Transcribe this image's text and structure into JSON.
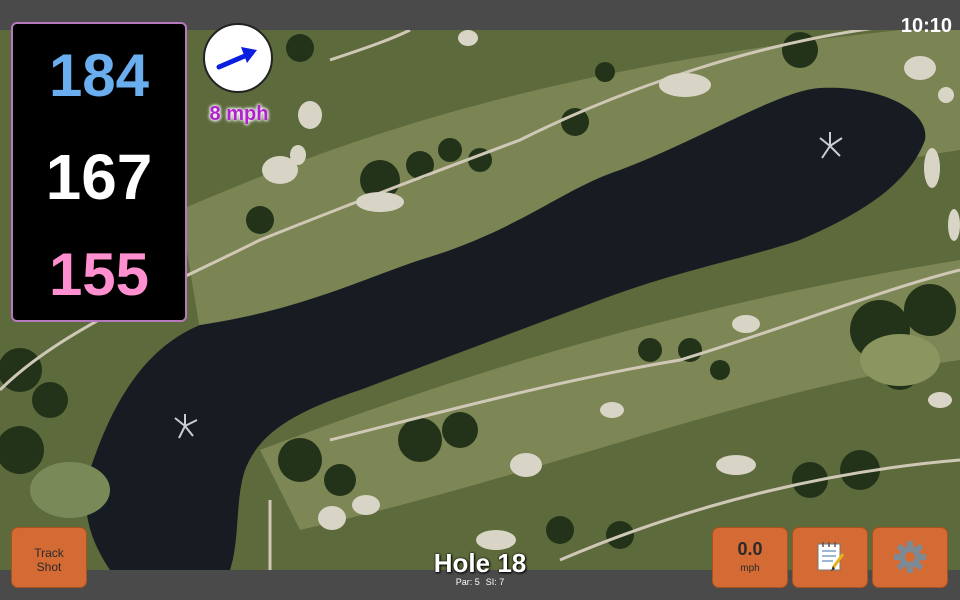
{
  "status": {
    "time": "10:10"
  },
  "distances": {
    "back": "184",
    "middle": "167",
    "front": "155"
  },
  "wind": {
    "speed_text": "8 mph",
    "direction_icon": "arrow-icon",
    "arrow_color": "#0a1ee0"
  },
  "hole": {
    "title": "Hole 18",
    "par": "Par: 5",
    "si": "SI: 7"
  },
  "buttons": {
    "track_shot_line1": "Track",
    "track_shot_line2": "Shot",
    "speed_value": "0.0",
    "speed_unit": "mph",
    "notes_icon": "notepad-icon",
    "settings_icon": "gear-icon"
  },
  "colors": {
    "back_distance": "#6aaef0",
    "middle_distance": "#ffffff",
    "front_distance": "#ff8fcf",
    "button": "#d46a34",
    "panel_border": "#b878c0"
  }
}
